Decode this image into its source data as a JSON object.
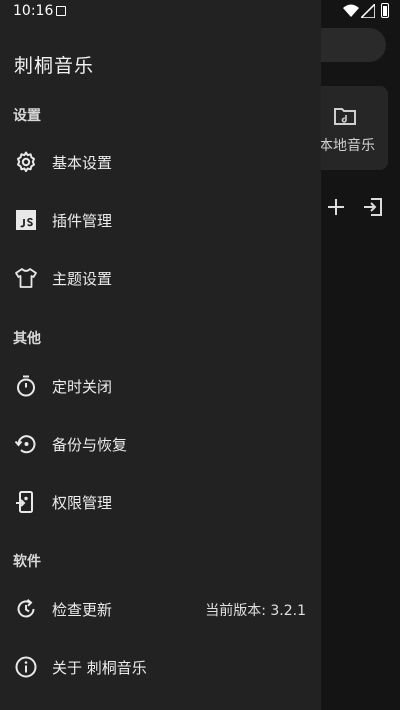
{
  "status_bar": {
    "time": "10:16"
  },
  "background": {
    "card_label": "本地音乐"
  },
  "drawer": {
    "app_title": "刺桐音乐",
    "sections": {
      "settings": {
        "title": "设置"
      },
      "others": {
        "title": "其他"
      },
      "software": {
        "title": "软件"
      }
    },
    "items": {
      "basic_settings": {
        "label": "基本设置",
        "icon": "gear-icon"
      },
      "plugin_manage": {
        "label": "插件管理",
        "icon": "js-icon"
      },
      "theme_settings": {
        "label": "主题设置",
        "icon": "tshirt-icon"
      },
      "timer_close": {
        "label": "定时关闭",
        "icon": "timer-icon"
      },
      "backup_restore": {
        "label": "备份与恢复",
        "icon": "restore-icon"
      },
      "permission_manage": {
        "label": "权限管理",
        "icon": "permission-icon"
      },
      "check_update": {
        "label": "检查更新",
        "extra": "当前版本: 3.2.1",
        "icon": "update-icon"
      },
      "about": {
        "label": "关于 刺桐音乐",
        "icon": "info-icon"
      }
    }
  },
  "colors": {
    "drawer_bg": "#222222",
    "background": "#141414",
    "text": "#ececec"
  }
}
